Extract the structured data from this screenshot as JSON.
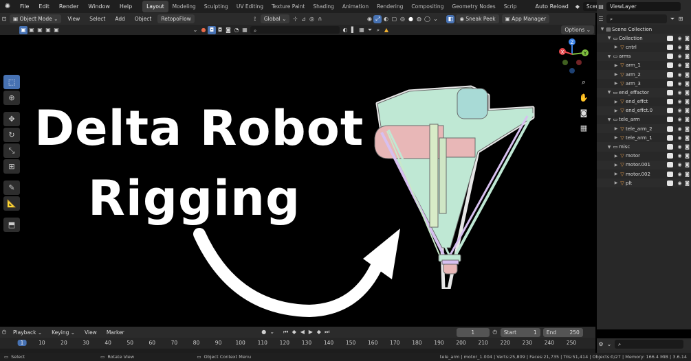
{
  "menu": {
    "items": [
      "File",
      "Edit",
      "Render",
      "Window",
      "Help"
    ],
    "workspaces": [
      "Layout",
      "Modeling",
      "Sculpting",
      "UV Editing",
      "Texture Paint",
      "Shading",
      "Animation",
      "Rendering",
      "Compositing",
      "Geometry Nodes",
      "Scrip"
    ],
    "active_workspace": "Layout",
    "auto_reload": "Auto Reload",
    "scene": "Scene",
    "view_layer": "ViewLayer"
  },
  "header": {
    "mode": "Object Mode",
    "view": "View",
    "select": "Select",
    "add": "Add",
    "object": "Object",
    "addon": "RetopoFlow",
    "orientation": "Global",
    "sneak_peek": "Sneak Peek",
    "app_manager": "App Manager",
    "options": "Options"
  },
  "viewport": {
    "title_line1": "Delta Robot",
    "title_line2": "Rigging",
    "gizmo_axes": [
      "X",
      "Y",
      "Z"
    ]
  },
  "outliner": {
    "rows": [
      {
        "name": "Scene Collection",
        "level": 0,
        "icon": "scene",
        "expanded": true,
        "root": true
      },
      {
        "name": "Collection",
        "level": 1,
        "icon": "collection",
        "expanded": true
      },
      {
        "name": "cntrl",
        "level": 2,
        "icon": "mesh",
        "expanded": false
      },
      {
        "name": "arms",
        "level": 1,
        "icon": "collection",
        "expanded": true
      },
      {
        "name": "arm_1",
        "level": 2,
        "icon": "mesh",
        "expanded": false
      },
      {
        "name": "arm_2",
        "level": 2,
        "icon": "mesh",
        "expanded": false
      },
      {
        "name": "arm_3",
        "level": 2,
        "icon": "mesh",
        "expanded": false
      },
      {
        "name": "end_effactor",
        "level": 1,
        "icon": "collection",
        "expanded": true
      },
      {
        "name": "end_effct",
        "level": 2,
        "icon": "mesh",
        "expanded": false
      },
      {
        "name": "end_effct.0",
        "level": 2,
        "icon": "mesh",
        "expanded": false
      },
      {
        "name": "tele_arm",
        "level": 1,
        "icon": "collection",
        "expanded": true
      },
      {
        "name": "tele_arm_2",
        "level": 2,
        "icon": "mesh",
        "expanded": false
      },
      {
        "name": "tele_arm_1",
        "level": 2,
        "icon": "mesh",
        "expanded": false
      },
      {
        "name": "misc",
        "level": 1,
        "icon": "collection",
        "expanded": true
      },
      {
        "name": "motor",
        "level": 2,
        "icon": "mesh",
        "expanded": false
      },
      {
        "name": "motor.001",
        "level": 2,
        "icon": "mesh",
        "expanded": false
      },
      {
        "name": "motor.002",
        "level": 2,
        "icon": "mesh",
        "expanded": false
      },
      {
        "name": "plt",
        "level": 2,
        "icon": "mesh",
        "expanded": false
      }
    ]
  },
  "timeline": {
    "playback": "Playback",
    "keying": "Keying",
    "view": "View",
    "marker": "Marker",
    "current_frame": "1",
    "start_label": "Start",
    "start": "1",
    "end_label": "End",
    "end": "250",
    "ticks": [
      "1",
      "10",
      "20",
      "30",
      "40",
      "50",
      "60",
      "70",
      "80",
      "90",
      "100",
      "110",
      "120",
      "130",
      "140",
      "150",
      "160",
      "170",
      "180",
      "190",
      "200",
      "210",
      "220",
      "230",
      "240",
      "250"
    ]
  },
  "status": {
    "select": "Select",
    "rotate_view": "Rotate View",
    "context_menu": "Object Context Menu",
    "stats": "tele_arm | motor_1.004 | Verts:25,809 | Faces:21,735 | Tris:51,414 | Objects:0/27 | Memory: 166.4 MiB | 3.6.14"
  },
  "colors": {
    "accent": "#4772b3",
    "axis_x": "#e5484d",
    "axis_y": "#7fbf3f",
    "axis_z": "#3b82e6",
    "robot_mint": "#bfe8d4",
    "robot_pink": "#e8b7b7",
    "robot_lilac": "#d7c0f0",
    "collection_white": "#e6e6e6",
    "mesh_orange": "#f0a24a"
  }
}
